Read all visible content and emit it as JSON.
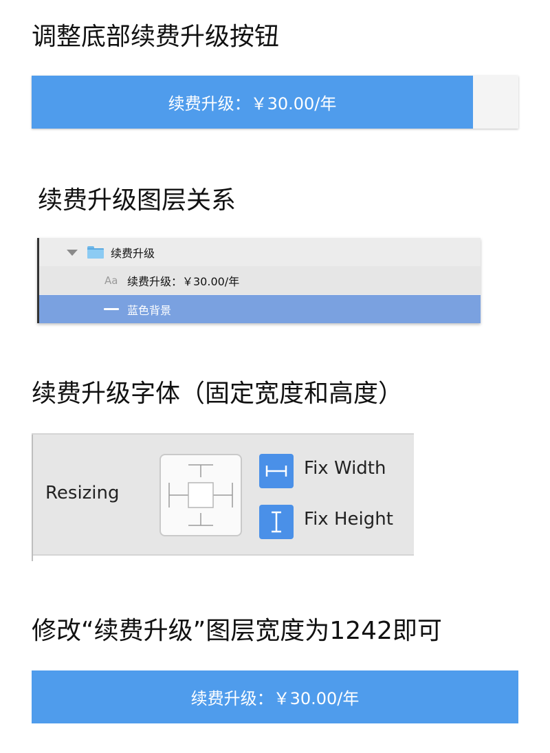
{
  "section1": {
    "title": "调整底部续费升级按钮",
    "button_label": "续费升级：￥30.00/年"
  },
  "section2": {
    "title": "续费升级图层关系",
    "layers": [
      {
        "label": "续费升级",
        "icon": "folder-icon"
      },
      {
        "label": "续费升级：￥30.00/年",
        "icon": "text-layer-icon",
        "icon_text": "Aa"
      },
      {
        "label": "蓝色背景",
        "icon": "rectangle-layer-icon"
      }
    ]
  },
  "section3": {
    "title": "续费升级字体（固定宽度和高度）",
    "resizing_label": "Resizing",
    "fix_width_label": "Fix Width",
    "fix_height_label": "Fix Height"
  },
  "section4": {
    "title": "修改“续费升级”图层宽度为1242即可",
    "button_label": "续费升级：￥30.00/年"
  },
  "colors": {
    "button_blue": "#4f9cec",
    "selected_layer": "#7aa1e0",
    "fix_button_blue": "#4a90e8"
  }
}
